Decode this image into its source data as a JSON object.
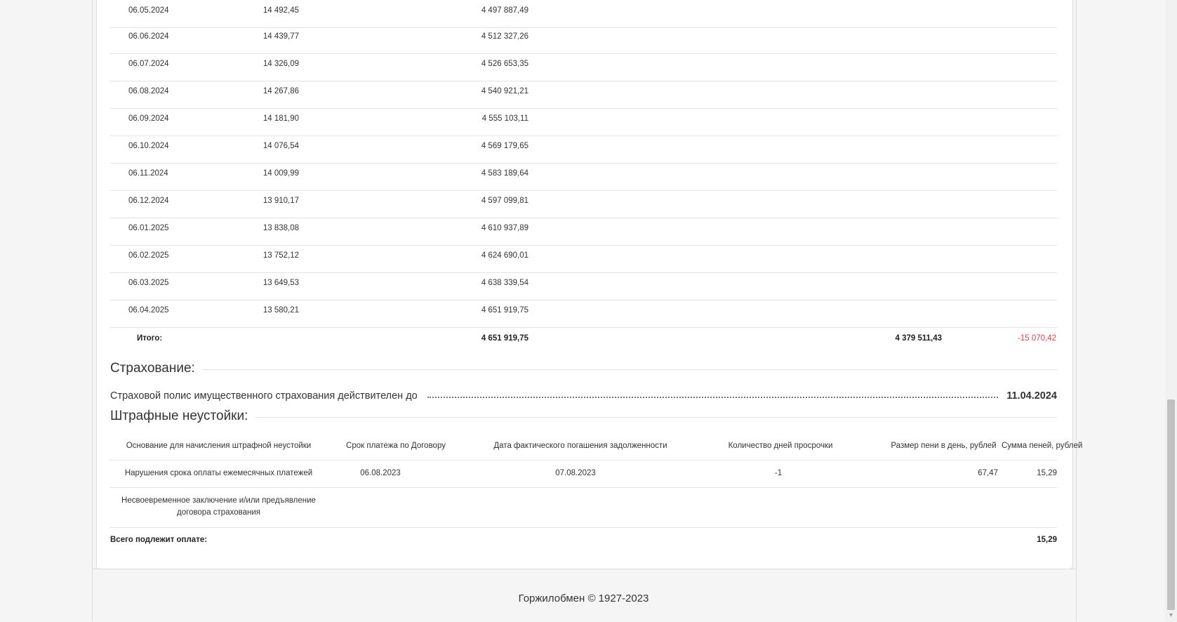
{
  "schedule": {
    "rows": [
      {
        "date": "06.05.2024",
        "payment": "14 492,45",
        "balance": "4 497 887,49"
      },
      {
        "date": "06.06.2024",
        "payment": "14 439,77",
        "balance": "4 512 327,26"
      },
      {
        "date": "06.07.2024",
        "payment": "14 326,09",
        "balance": "4 526 653,35"
      },
      {
        "date": "06.08.2024",
        "payment": "14 267,86",
        "balance": "4 540 921,21"
      },
      {
        "date": "06.09.2024",
        "payment": "14 181,90",
        "balance": "4 555 103,11"
      },
      {
        "date": "06.10.2024",
        "payment": "14 076,54",
        "balance": "4 569 179,65"
      },
      {
        "date": "06.11.2024",
        "payment": "14 009,99",
        "balance": "4 583 189,64"
      },
      {
        "date": "06.12.2024",
        "payment": "13 910,17",
        "balance": "4 597 099,81"
      },
      {
        "date": "06.01.2025",
        "payment": "13 838,08",
        "balance": "4 610 937,89"
      },
      {
        "date": "06.02.2025",
        "payment": "13 752,12",
        "balance": "4 624 690,01"
      },
      {
        "date": "06.03.2025",
        "payment": "13 649,53",
        "balance": "4 638 339,54"
      },
      {
        "date": "06.04.2025",
        "payment": "13 580,21",
        "balance": "4 651 919,75"
      }
    ],
    "total": {
      "label": "Итого:",
      "balance": "4 651 919,75",
      "paid": "4 379 511,43",
      "difference": "-15 070,42"
    }
  },
  "insurance": {
    "title": "Страхование:",
    "policy_label": "Страховой полис имущественного страхования действителен до",
    "policy_date": "11.04.2024"
  },
  "penalties": {
    "title": "Штрафные неустойки:",
    "headers": [
      "Основание для начисления штрафной неустойки",
      "Срок платежа по Договору",
      "Дата фактического погашения задолженности",
      "Количество дней просрочки",
      "Размер пени в день, рублей",
      "Сумма пеней, рублей"
    ],
    "rows": [
      {
        "reason": "Нарушения срока оплаты ежемесячных платежей",
        "due": "06.08.2023",
        "paid": "07.08.2023",
        "days": "-1",
        "per_day": "67,47",
        "sum": "15,29"
      },
      {
        "reason": "Несвоевременное заключение и/или предъявление договора страхования"
      }
    ],
    "total_label": "Всего подлежит оплате:",
    "total_value": "15,29"
  },
  "footer": {
    "text": "Горжилобмен © 1927-2023"
  },
  "colors": {
    "negative": "#e2404a",
    "border": "#e4e4e4",
    "background": "#f5f5f5"
  }
}
